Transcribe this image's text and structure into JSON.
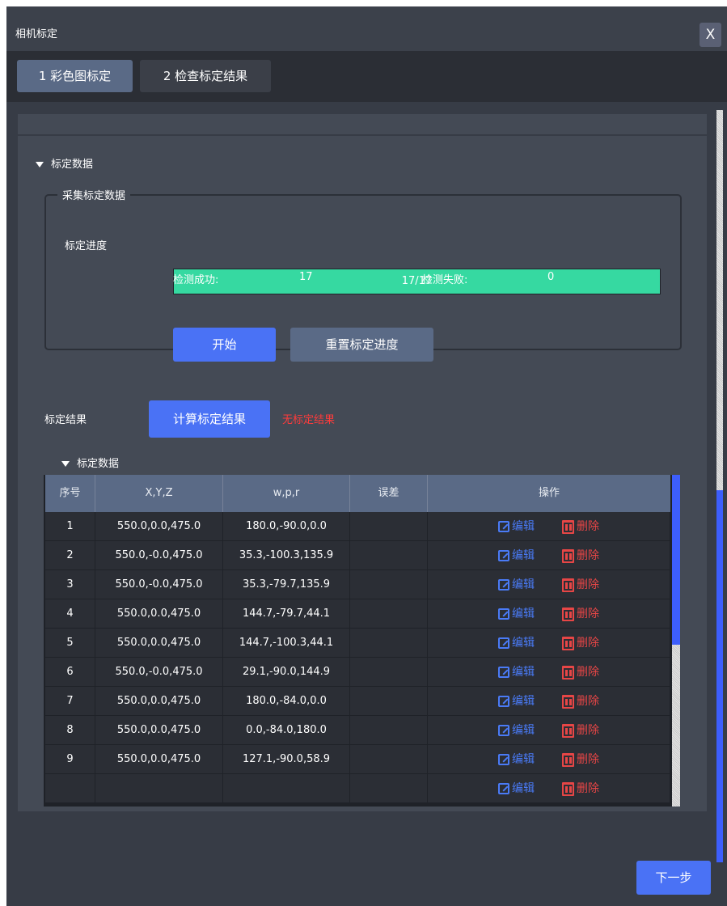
{
  "window": {
    "title": "相机标定",
    "close_label": "X"
  },
  "tabs": [
    {
      "label": "1 彩色图标定",
      "active": true
    },
    {
      "label": "2 检查标定结果",
      "active": false
    }
  ],
  "calibration_section": {
    "title": "标定数据"
  },
  "collect_group": {
    "legend": "采集标定数据",
    "progress_label": "标定进度",
    "progress_text": "17/17",
    "progress_fraction": 1.0,
    "success_label": "检测成功:",
    "success_count": "17",
    "fail_label": "检测失败:",
    "fail_count": "0",
    "start_label": "开始",
    "reset_label": "重置标定进度"
  },
  "result": {
    "label": "标定结果",
    "compute_label": "计算标定结果",
    "status_text": "无标定结果",
    "status_color": "#ff3b3b"
  },
  "data_table": {
    "title": "标定数据",
    "columns": [
      "序号",
      "X,Y,Z",
      "w,p,r",
      "误差",
      "操作"
    ],
    "rows": [
      {
        "idx": "1",
        "xyz": "550.0,0.0,475.0",
        "wpr": "180.0,-90.0,0.0",
        "err": ""
      },
      {
        "idx": "2",
        "xyz": "550.0,-0.0,475.0",
        "wpr": "35.3,-100.3,135.9",
        "err": ""
      },
      {
        "idx": "3",
        "xyz": "550.0,-0.0,475.0",
        "wpr": "35.3,-79.7,135.9",
        "err": ""
      },
      {
        "idx": "4",
        "xyz": "550.0,0.0,475.0",
        "wpr": "144.7,-79.7,44.1",
        "err": ""
      },
      {
        "idx": "5",
        "xyz": "550.0,0.0,475.0",
        "wpr": "144.7,-100.3,44.1",
        "err": ""
      },
      {
        "idx": "6",
        "xyz": "550.0,-0.0,475.0",
        "wpr": "29.1,-90.0,144.9",
        "err": ""
      },
      {
        "idx": "7",
        "xyz": "550.0,0.0,475.0",
        "wpr": "180.0,-84.0,0.0",
        "err": ""
      },
      {
        "idx": "8",
        "xyz": "550.0,0.0,475.0",
        "wpr": "0.0,-84.0,180.0",
        "err": ""
      },
      {
        "idx": "9",
        "xyz": "550.0,0.0,475.0",
        "wpr": "127.1,-90.0,58.9",
        "err": ""
      }
    ],
    "edit_label": "编辑",
    "delete_label": "删除",
    "edit_icon": "edit-icon",
    "delete_icon": "trash-icon"
  },
  "footer": {
    "next_label": "下一步"
  },
  "colors": {
    "accent": "#4a72f5",
    "progress": "#36d9a1",
    "edit": "#4a7bf7",
    "delete": "#e74646"
  }
}
